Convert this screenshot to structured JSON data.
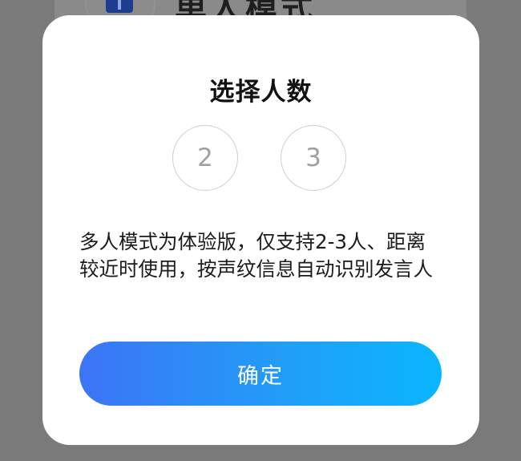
{
  "background": {
    "title": "单人模式",
    "icon": "bookmark-icon"
  },
  "dialog": {
    "title": "选择人数",
    "options": [
      {
        "label": "2"
      },
      {
        "label": "3"
      }
    ],
    "description": "多人模式为体验版，仅支持2-3人、距离较近时使用，按声纹信息自动识别发言人",
    "confirm_label": "确定"
  },
  "colors": {
    "overlay": "#7a7a7a",
    "dialog_bg": "#ffffff",
    "button_gradient_start": "#3d74f6",
    "button_gradient_end": "#0ab6ff",
    "option_border": "#cfcfcf",
    "option_text": "#a0a0a0"
  }
}
